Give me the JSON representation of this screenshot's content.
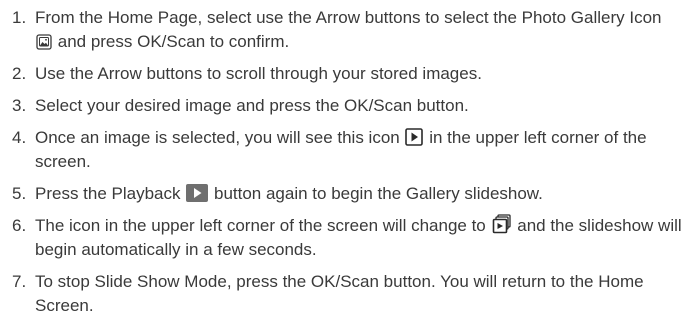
{
  "steps": [
    {
      "num": "1.",
      "before": "From the Home Page, select use the Arrow buttons to select the Photo Gallery Icon",
      "icon": "photo-gallery-icon",
      "after": "and press OK/Scan to confirm."
    },
    {
      "num": "2.",
      "text": "Use the Arrow buttons to scroll through your stored images."
    },
    {
      "num": "3.",
      "text": "Select your desired image and press the OK/Scan button."
    },
    {
      "num": "4.",
      "before": "Once an image is selected, you will see this icon",
      "icon": "play-icon",
      "after": "in the upper left corner of the screen."
    },
    {
      "num": "5.",
      "before": "Press the Playback",
      "icon": "playback-button-icon",
      "after": "button again to begin the Gallery slideshow."
    },
    {
      "num": "6.",
      "before": "The icon in the upper left corner of the screen will change to",
      "icon": "slideshow-icon",
      "after": "and the slideshow will begin automatically in a few seconds."
    },
    {
      "num": "7.",
      "text": "To stop Slide Show Mode, press the OK/Scan button. You will return to the Home Screen."
    }
  ]
}
